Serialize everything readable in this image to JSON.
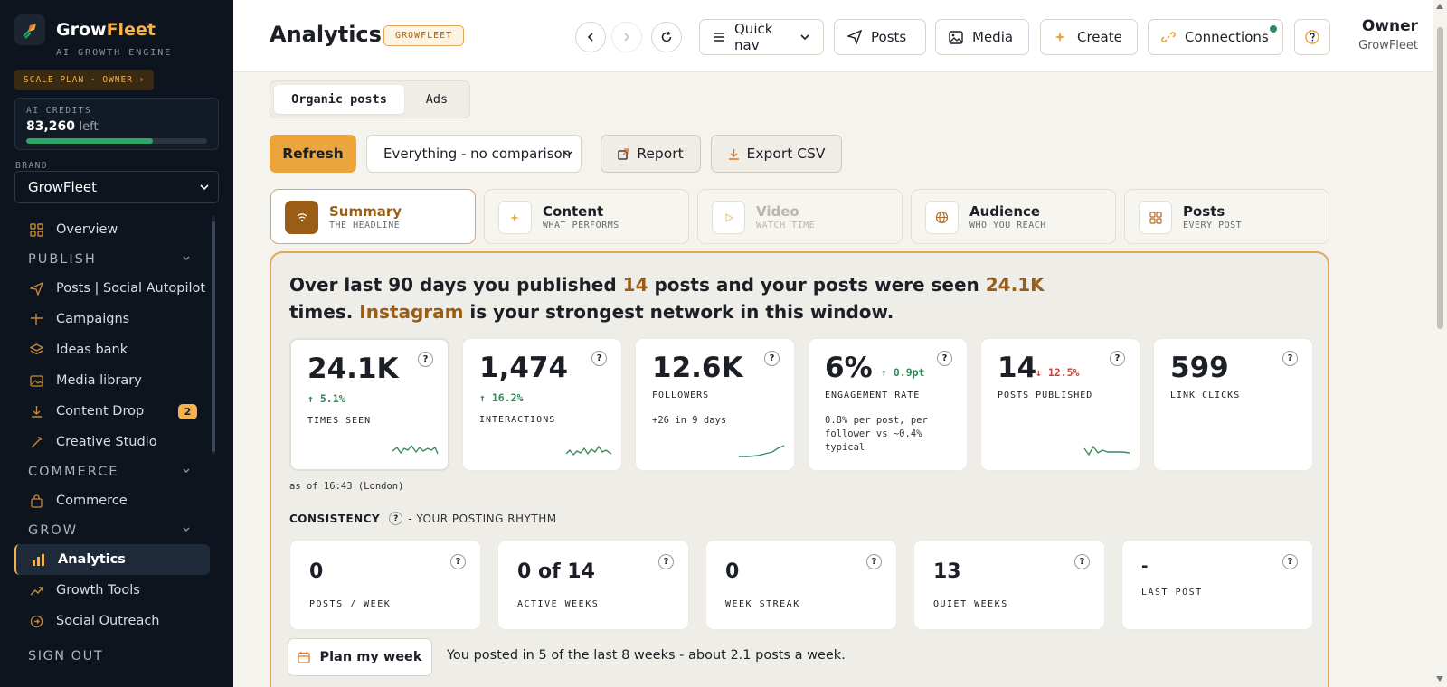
{
  "sidebar": {
    "brand_first": "Grow",
    "brand_second": "Fleet",
    "tagline": "AI GROWTH ENGINE",
    "plan_badge": "SCALE PLAN · OWNER ›",
    "credits_label": "AI CREDITS",
    "credits_value": "83,260",
    "credits_suffix": "left",
    "credits_fraction": 0.7,
    "brand_label": "BRAND",
    "brand_selected": "GrowFleet",
    "items": [
      {
        "label": "Overview",
        "icon": "grid-icon"
      },
      {
        "section": "PUBLISH"
      },
      {
        "label": "Posts | Social Autopilot",
        "icon": "send-icon"
      },
      {
        "label": "Campaigns",
        "icon": "campaign-icon"
      },
      {
        "label": "Ideas bank",
        "icon": "layers-icon"
      },
      {
        "label": "Media library",
        "icon": "image-icon"
      },
      {
        "label": "Content Drop",
        "icon": "download-icon",
        "badge": "2"
      },
      {
        "label": "Creative Studio",
        "icon": "wand-icon"
      },
      {
        "section": "COMMERCE"
      },
      {
        "label": "Commerce",
        "icon": "bag-icon"
      },
      {
        "section": "GROW"
      },
      {
        "label": "Analytics",
        "icon": "bar-chart-icon",
        "active": true
      },
      {
        "label": "Growth Tools",
        "icon": "trend-icon"
      },
      {
        "label": "Social Outreach",
        "icon": "outreach-icon"
      }
    ],
    "sign_out": "SIGN OUT"
  },
  "header": {
    "title": "Analytics",
    "badge": "GROWFLEET",
    "quick_nav": "Quick nav",
    "posts": "Posts",
    "media": "Media",
    "create": "Create",
    "connections": "Connections",
    "user_name": "Owner",
    "user_org": "GrowFleet"
  },
  "main": {
    "segments": [
      "Organic posts",
      "Ads"
    ],
    "refresh": "Refresh",
    "comparison": "Everything - no comparison",
    "report": "Report",
    "export": "Export CSV",
    "tabs": [
      {
        "title": "Summary",
        "sub": "THE HEADLINE",
        "icon": "wifi-icon"
      },
      {
        "title": "Content",
        "sub": "WHAT PERFORMS",
        "icon": "sparkle-icon"
      },
      {
        "title": "Video",
        "sub": "WATCH TIME",
        "icon": "play-icon"
      },
      {
        "title": "Audience",
        "sub": "WHO YOU REACH",
        "icon": "globe-icon"
      },
      {
        "title": "Posts",
        "sub": "EVERY POST",
        "icon": "grid-icon"
      }
    ],
    "headline": {
      "p1": "Over last 90 days you published ",
      "posts": "14",
      "p2": " posts and your posts were seen ",
      "seen": "24.1K",
      "p3": " times. ",
      "network": "Instagram",
      "p4": " is your strongest network in this window."
    },
    "kpis": [
      {
        "value": "24.1K",
        "delta": "↑ 5.1%",
        "label": "TIMES SEEN"
      },
      {
        "value": "1,474",
        "delta": "↑ 16.2%",
        "label": "INTERACTIONS"
      },
      {
        "value": "12.6K",
        "label": "FOLLOWERS",
        "sub": "+26 in 9 days"
      },
      {
        "value": "6%",
        "delta": "↑ 0.9pt",
        "label": "ENGAGEMENT RATE",
        "sub": "0.8% per post, per follower vs ~0.4% typical"
      },
      {
        "value": "14",
        "delta": "↓ 12.5%",
        "label": "POSTS PUBLISHED"
      },
      {
        "value": "599",
        "label": "LINK CLICKS"
      }
    ],
    "as_of": "as of 16:43 (London)",
    "consistency_title": "CONSISTENCY",
    "consistency_sub": "- YOUR POSTING RHYTHM",
    "consistency": [
      {
        "value": "0",
        "label": "POSTS / WEEK"
      },
      {
        "value": "0 of 14",
        "label": "ACTIVE WEEKS"
      },
      {
        "value": "0",
        "label": "WEEK STREAK"
      },
      {
        "value": "13",
        "label": "QUIET WEEKS"
      },
      {
        "value": "-",
        "label": "LAST POST"
      }
    ],
    "plan_button": "Plan my week",
    "plan_note": "You posted in 5 of the last 8 weeks - about 2.1 posts a week."
  },
  "colors": {
    "accent": "#eaa63c",
    "brand_dark": "#9a5d16",
    "up": "#2f8a5a",
    "down": "#c9453c",
    "sidebar": "#0e141d"
  }
}
